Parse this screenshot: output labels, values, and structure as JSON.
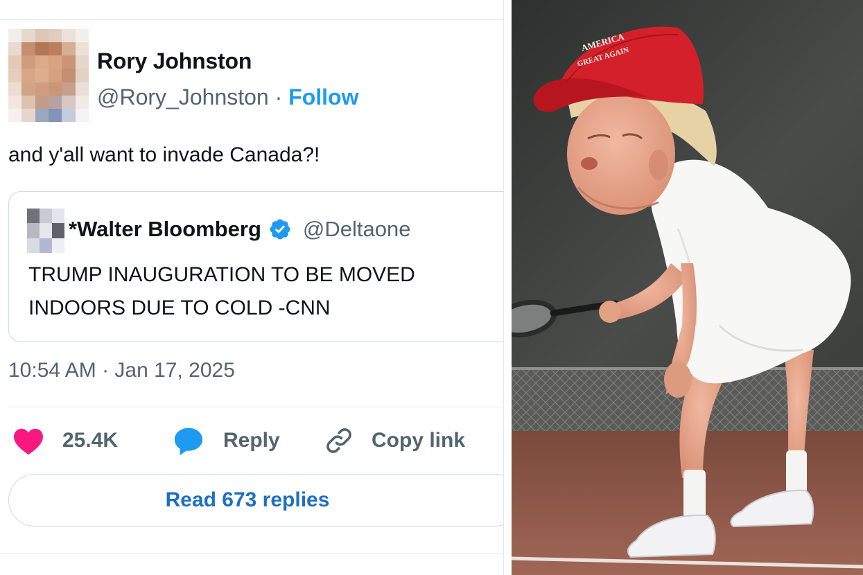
{
  "tweet": {
    "author": {
      "name": "Rory Johnston",
      "handle": "@Rory_Johnston",
      "separator": "·",
      "follow_label": "Follow"
    },
    "text": "and y'all want to invade Canada?!",
    "quoted": {
      "name": "*Walter Bloomberg",
      "handle": "@Deltaone",
      "text": "TRUMP INAUGURATION TO BE MOVED INDOORS DUE TO COLD -CNN"
    },
    "timestamp": "10:54 AM · Jan 17, 2025",
    "actions": {
      "likes": "25.4K",
      "reply_label": "Reply",
      "copy_link_label": "Copy link"
    },
    "read_replies_label": "Read 673 replies"
  },
  "photo": {
    "cap_text_line1": "AMERICA",
    "cap_text_line2": "GREAT AGAIN"
  },
  "colors": {
    "link_blue": "#1d9bf0",
    "heart_pink": "#f91880",
    "reply_blue": "#1d9bf0",
    "muted_text": "#536471",
    "cap_red": "#d4202a"
  },
  "icons": [
    "verified-badge-icon",
    "heart-icon",
    "reply-bubble-icon",
    "link-icon"
  ]
}
